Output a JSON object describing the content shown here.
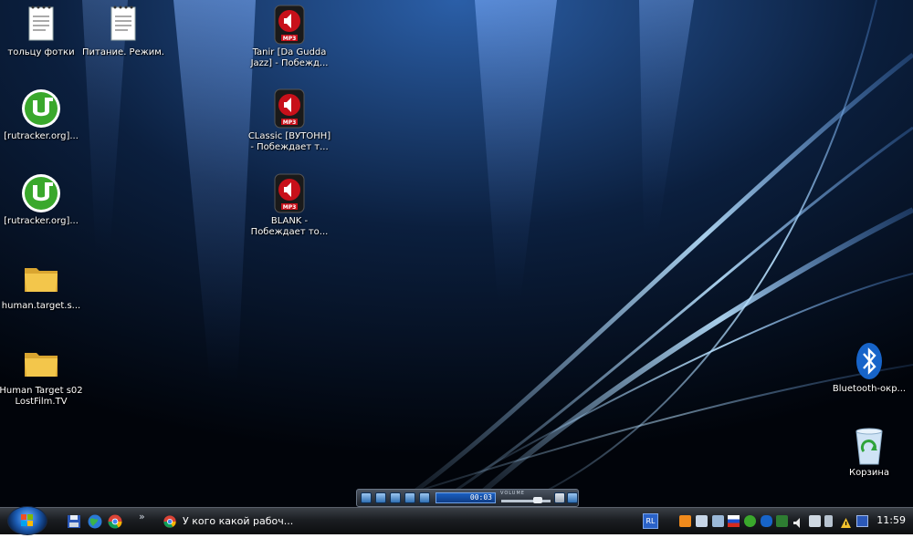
{
  "desktop_icons": [
    {
      "name": "text-file-icon",
      "label": "тольцу фотки"
    },
    {
      "name": "text-file-icon",
      "label": "Питание. Режим."
    },
    {
      "name": "mp3-file-icon",
      "label": "Tanir [Da Gudda Jazz] - Побежд..."
    },
    {
      "name": "utorrent-icon",
      "label": "[rutracker.org]..."
    },
    {
      "name": "mp3-file-icon",
      "label": "CLassic [ВУТОНН] - Побеждает т..."
    },
    {
      "name": "utorrent-icon",
      "label": "[rutracker.org]..."
    },
    {
      "name": "mp3-file-icon",
      "label": "BLANK - Побеждает то..."
    },
    {
      "name": "folder-icon",
      "label": "human.target.s..."
    },
    {
      "name": "folder-icon",
      "label": "Human Target s02 LostFilm.TV"
    },
    {
      "name": "bluetooth-icon",
      "label": "Bluetooth-окр..."
    },
    {
      "name": "recycle-bin-icon",
      "label": "Корзина"
    }
  ],
  "media_player": {
    "time": "00:03",
    "volume_label": "VOLUME",
    "volume_level": 0.8
  },
  "taskbar": {
    "overflow_glyph": "»",
    "window_button": "У кого какой рабоч...",
    "language": "RL",
    "clock": "11:59"
  },
  "colors": {
    "accent": "#1d5fb8",
    "mp3_icon_red": "#c8101a",
    "utorrent_green": "#3aa82c",
    "folder_yellow": "#f3c64b"
  }
}
